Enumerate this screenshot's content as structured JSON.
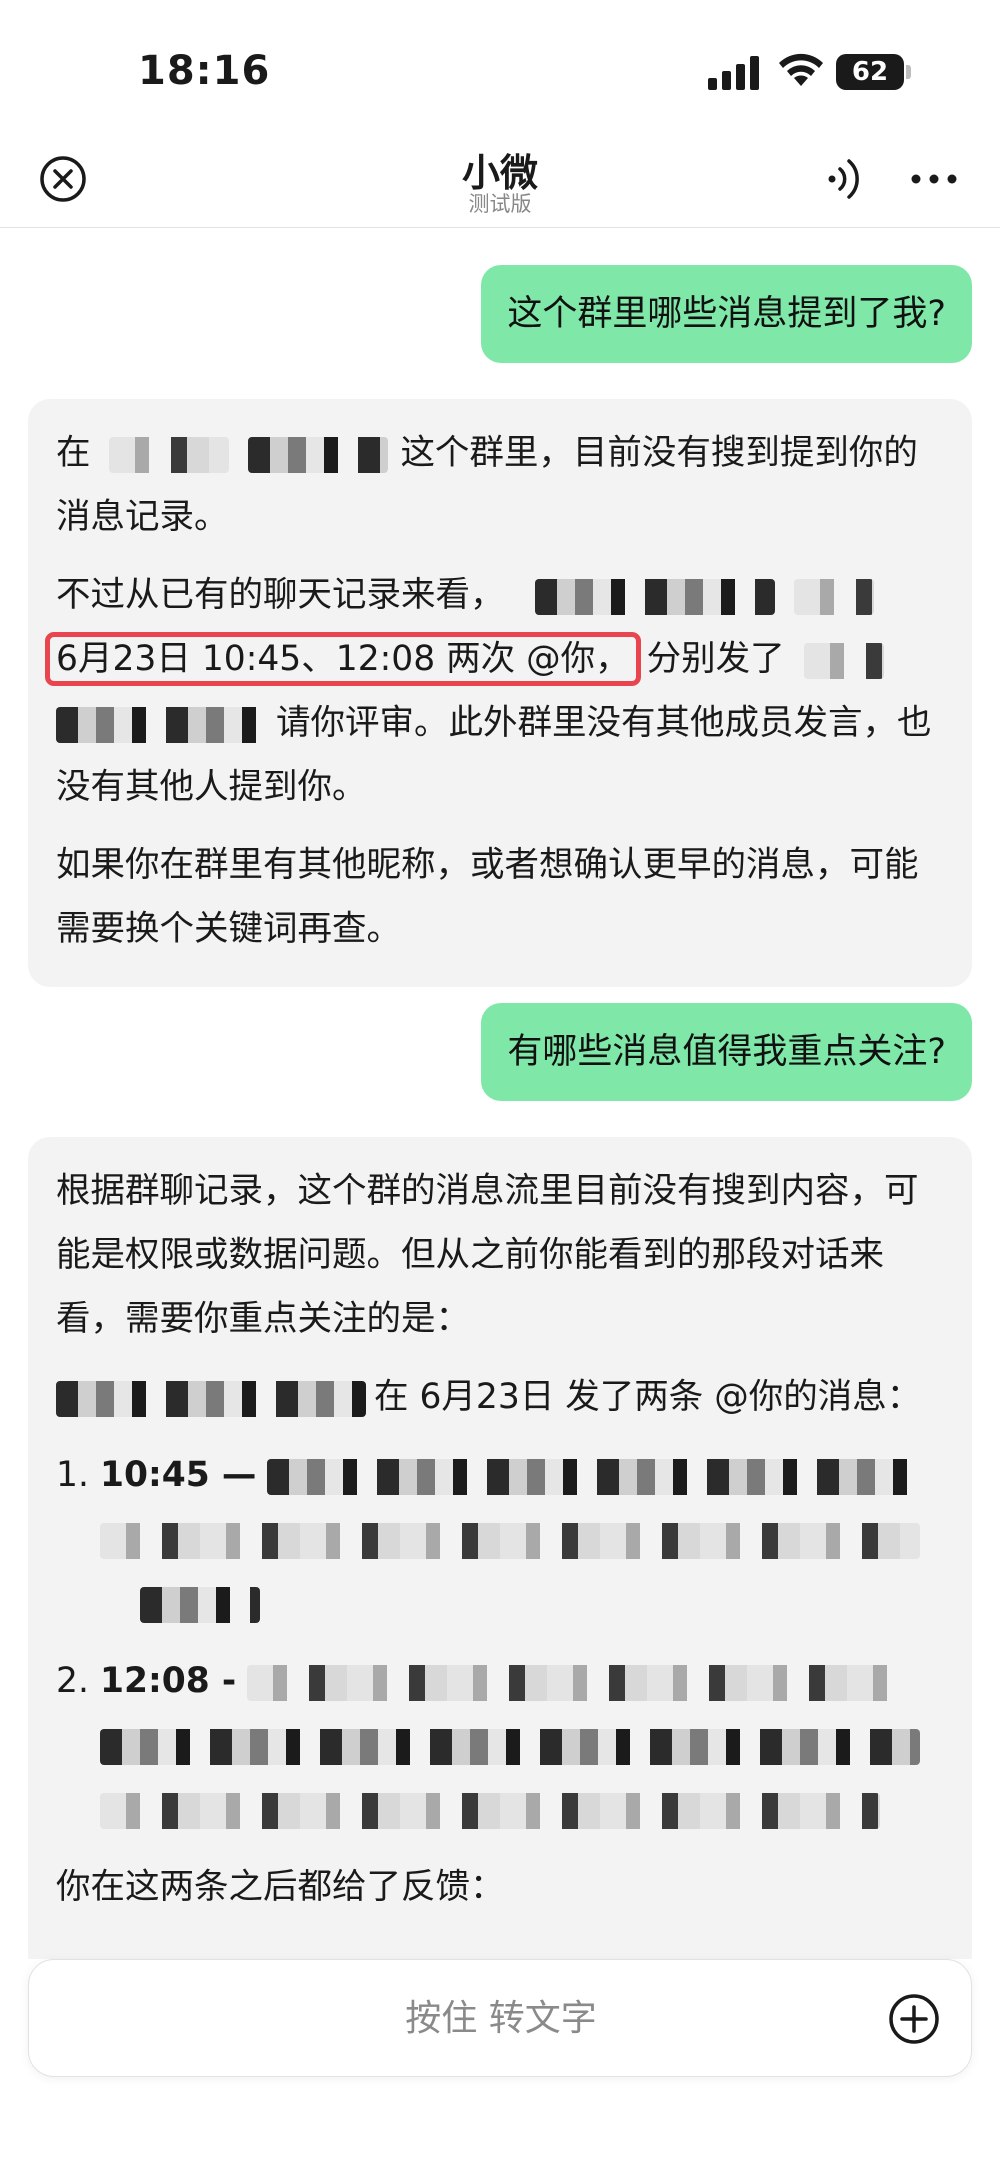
{
  "status": {
    "time": "18:16",
    "battery": "62",
    "battery_level": 0.62
  },
  "nav": {
    "title": "小微",
    "subtitle": "测试版"
  },
  "messages": {
    "q1": "这个群里哪些消息提到了我?",
    "a1": {
      "p1_pre": "在",
      "p1_post": "这个群里，目前没有搜到提到你的消息记录。",
      "p2_pre": "不过从已有的聊天记录来看，",
      "p2_highlight": "6月23日 10:45、12:08 两次 @你，",
      "p2_mid": "分别发了",
      "p2_post": "请你评审。此外群里没有其他成员发言，也没有其他人提到你。",
      "p3": "如果你在群里有其他昵称，或者想确认更早的消息，可能需要换个关键词再查。"
    },
    "q2": "有哪些消息值得我重点关注?",
    "a2": {
      "p1": "根据群聊记录，这个群的消息流里目前没有搜到内容，可能是权限或数据问题。但从之前你能看到的那段对话来看，需要你重点关注的是：",
      "p2_post": "在 6月23日 发了两条 @你的消息：",
      "item1_num": "1.",
      "item1_time": "10:45 —",
      "item2_num": "2.",
      "item2_time": "12:08 -",
      "p3": "你在这两条之后都给了反馈："
    }
  },
  "input": {
    "placeholder": "按住 转文字"
  },
  "colors": {
    "user_bubble": "#7fe8a9",
    "bot_bubble": "#f3f3f3",
    "highlight_border": "#e8454f"
  }
}
